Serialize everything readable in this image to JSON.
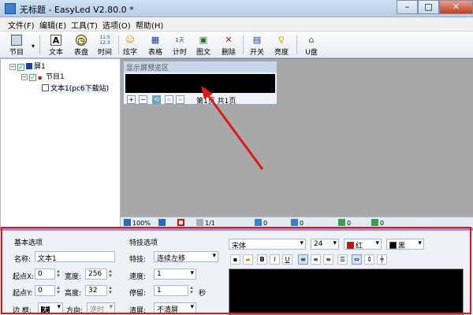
{
  "window": {
    "title": "无标题 - EasyLed V2.80.0 *",
    "controls": {
      "minimize": "–",
      "maximize": "□",
      "close": "✕"
    }
  },
  "menu": [
    "文件(F)",
    "编辑(E)",
    "工具(T)",
    "选项(O)",
    "帮助(H)"
  ],
  "toolbar": [
    {
      "id": "program",
      "label": "节目",
      "icon": "program-icon"
    },
    {
      "id": "text",
      "label": "文本",
      "icon": "text-icon"
    },
    {
      "id": "clock",
      "label": "表盘",
      "icon": "clock-icon"
    },
    {
      "id": "time",
      "label": "时间",
      "icon": "time-icon"
    },
    {
      "id": "effect-text",
      "label": "炫字",
      "icon": "smiley-icon"
    },
    {
      "id": "table",
      "label": "表格",
      "icon": "table-icon"
    },
    {
      "id": "timer",
      "label": "计时",
      "icon": "timer-icon"
    },
    {
      "id": "image-text",
      "label": "图文",
      "icon": "image-text-icon"
    },
    {
      "id": "delete",
      "label": "删除",
      "icon": "delete-icon"
    },
    {
      "id": "power",
      "label": "开关",
      "icon": "power-icon"
    },
    {
      "id": "brightness",
      "label": "亮度",
      "icon": "bulb-icon"
    },
    {
      "id": "udisk",
      "label": "U盘",
      "icon": "usb-icon"
    }
  ],
  "toolbar_icon_glyphs": {
    "timer": "1天",
    "time": "11:5 12:3"
  },
  "tree": {
    "screen": "屏1",
    "program": "节目1",
    "text_item": "文本1(pc6下载站)"
  },
  "preview": {
    "title": "显示屏预览区",
    "page_info": "第1页 共1页",
    "nav_buttons": [
      "+",
      "−",
      "⟲",
      "<",
      ">"
    ]
  },
  "statusbar": {
    "zoom": "100%",
    "page": "1/1",
    "value1": "0",
    "value2": "0",
    "value3": "0",
    "value4": "0"
  },
  "props": {
    "basic": {
      "heading": "基本选项",
      "name_label": "名称:",
      "name_value": "文本1",
      "x_label": "起点X:",
      "x_value": "0",
      "width_label": "宽度:",
      "width_value": "256",
      "y_label": "起点Y:",
      "y_value": "0",
      "height_label": "高度:",
      "height_value": "32",
      "border_label": "边 框:",
      "border_value": "无",
      "direction_label": "方向:",
      "direction_value": "逆时"
    },
    "effect": {
      "heading": "特技选项",
      "effect_label": "特技:",
      "effect_value": "连续左移",
      "speed_label": "速度:",
      "speed_value": "1",
      "stay_label": "停留:",
      "stay_value": "1",
      "stay_unit": "秒",
      "clear_label": "清屏:",
      "clear_value": "不清屏"
    },
    "font": {
      "family": "宋体",
      "size": "24",
      "fg_label": "红",
      "fg_color": "#e00000",
      "bg_label": "黑",
      "bg_color": "#000000"
    },
    "format_buttons": [
      "save",
      "open",
      "B",
      "I",
      "U",
      "align-left",
      "align-center",
      "align-right",
      "justify",
      "spacing-h",
      "spacing-v",
      "valign"
    ]
  },
  "colors": {
    "highlight_border": "#e01818",
    "arrow": "#e01818",
    "divider": "#9c8fd8"
  }
}
